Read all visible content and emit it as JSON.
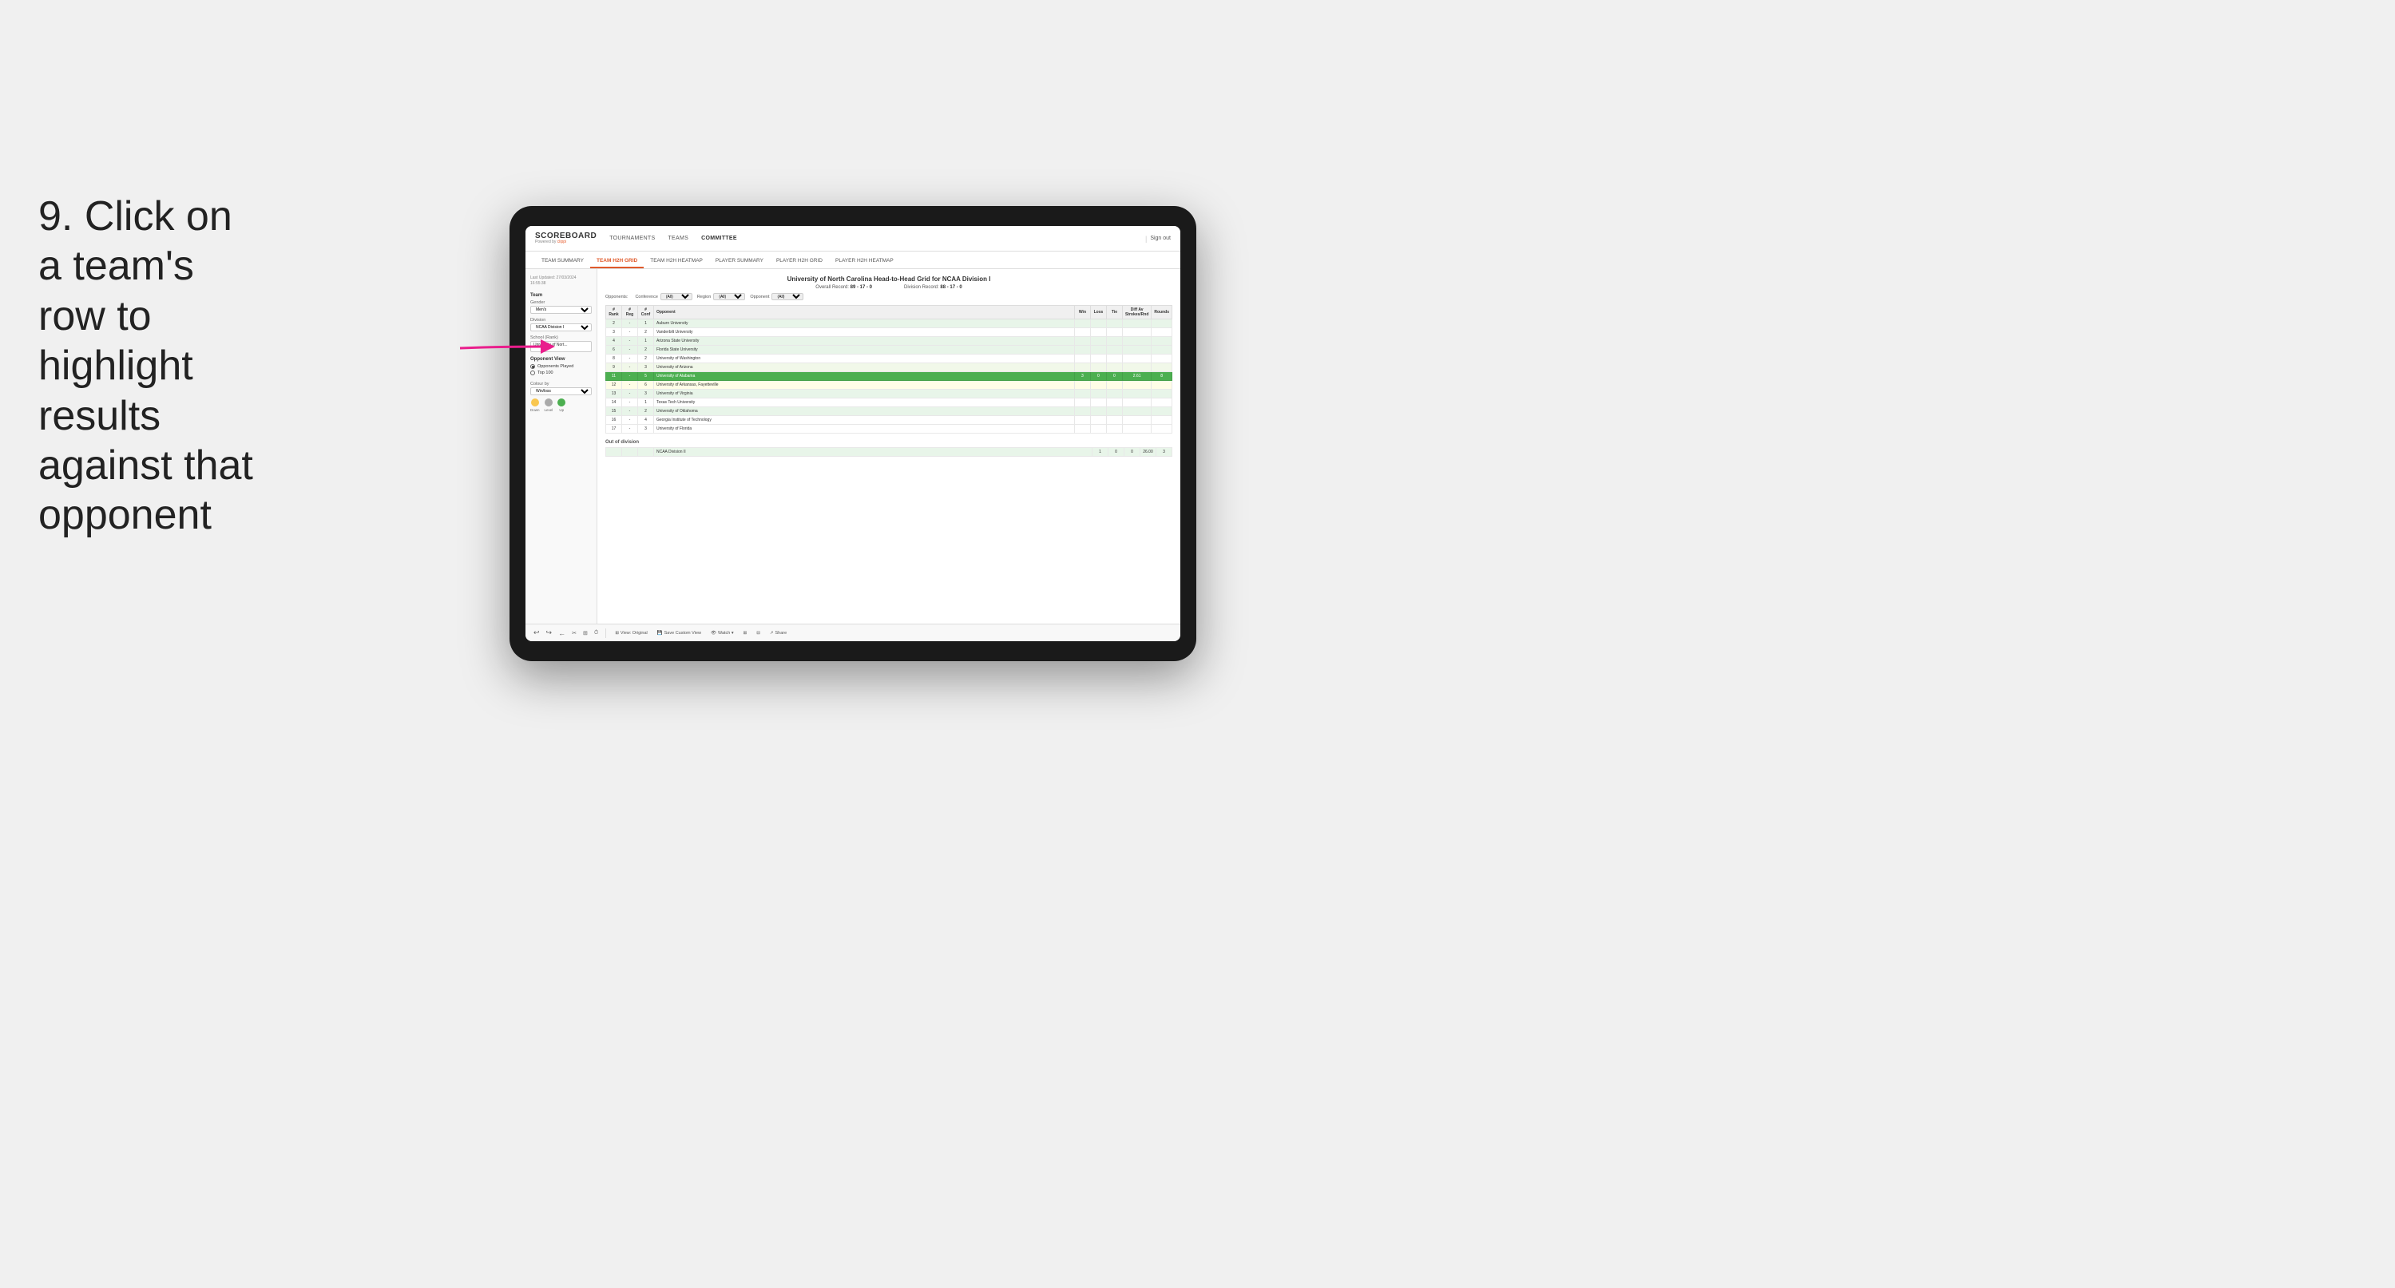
{
  "instruction": {
    "step": "9.",
    "text": "Click on a team's row to highlight results against that opponent"
  },
  "nav": {
    "logo": "SCOREBOARD",
    "powered_by": "Powered by clippi",
    "items": [
      "TOURNAMENTS",
      "TEAMS",
      "COMMITTEE"
    ],
    "sign_out": "Sign out"
  },
  "sub_nav": {
    "items": [
      "TEAM SUMMARY",
      "TEAM H2H GRID",
      "TEAM H2H HEATMAP",
      "PLAYER SUMMARY",
      "PLAYER H2H GRID",
      "PLAYER H2H HEATMAP"
    ],
    "active": "TEAM H2H GRID"
  },
  "sidebar": {
    "last_updated_label": "Last Updated: 27/03/2024",
    "last_updated_time": "16:55:38",
    "team_label": "Team",
    "gender_label": "Gender",
    "gender_value": "Men's",
    "division_label": "Division",
    "division_value": "NCAA Division I",
    "school_label": "School (Rank)",
    "school_value": "University of Nort...",
    "opponent_view_label": "Opponent View",
    "radio_opponents": "Opponents Played",
    "radio_top100": "Top 100",
    "colour_by_label": "Colour by",
    "colour_by_value": "Win/loss",
    "colours": [
      {
        "label": "Down",
        "color": "#f9c74f"
      },
      {
        "label": "Level",
        "color": "#aaaaaa"
      },
      {
        "label": "Up",
        "color": "#4caf50"
      }
    ]
  },
  "grid": {
    "title": "University of North Carolina Head-to-Head Grid for NCAA Division I",
    "overall_record_label": "Overall Record:",
    "overall_record": "89 - 17 - 0",
    "division_record_label": "Division Record:",
    "division_record": "88 - 17 - 0",
    "filters": {
      "opponents_label": "Opponents:",
      "conference_label": "Conference",
      "conference_value": "(All)",
      "region_label": "Region",
      "region_value": "(All)",
      "opponent_label": "Opponent",
      "opponent_value": "(All)"
    },
    "table_headers": [
      "#\nRank",
      "#\nReg",
      "#\nConf",
      "Opponent",
      "Win",
      "Loss",
      "Tie",
      "Diff Av\nStrokes/Rnd",
      "Rounds"
    ],
    "rows": [
      {
        "rank": "2",
        "reg": "-",
        "conf": "1",
        "opponent": "Auburn University",
        "win": "",
        "loss": "",
        "tie": "",
        "diff": "",
        "rounds": "",
        "style": "light-green"
      },
      {
        "rank": "3",
        "reg": "-",
        "conf": "2",
        "opponent": "Vanderbilt University",
        "win": "",
        "loss": "",
        "tie": "",
        "diff": "",
        "rounds": "",
        "style": ""
      },
      {
        "rank": "4",
        "reg": "-",
        "conf": "1",
        "opponent": "Arizona State University",
        "win": "",
        "loss": "",
        "tie": "",
        "diff": "",
        "rounds": "",
        "style": "light-green"
      },
      {
        "rank": "6",
        "reg": "-",
        "conf": "2",
        "opponent": "Florida State University",
        "win": "",
        "loss": "",
        "tie": "",
        "diff": "",
        "rounds": "",
        "style": "light-green"
      },
      {
        "rank": "8",
        "reg": "-",
        "conf": "2",
        "opponent": "University of Washington",
        "win": "",
        "loss": "",
        "tie": "",
        "diff": "",
        "rounds": "",
        "style": ""
      },
      {
        "rank": "9",
        "reg": "-",
        "conf": "3",
        "opponent": "University of Arizona",
        "win": "",
        "loss": "",
        "tie": "",
        "diff": "",
        "rounds": "",
        "style": "very-light-green"
      },
      {
        "rank": "11",
        "reg": "-",
        "conf": "5",
        "opponent": "University of Alabama",
        "win": "3",
        "loss": "0",
        "tie": "0",
        "diff": "2.61",
        "rounds": "8",
        "style": "highlighted"
      },
      {
        "rank": "12",
        "reg": "-",
        "conf": "6",
        "opponent": "University of Arkansas, Fayetteville",
        "win": "",
        "loss": "",
        "tie": "",
        "diff": "",
        "rounds": "",
        "style": "light-yellow"
      },
      {
        "rank": "13",
        "reg": "-",
        "conf": "3",
        "opponent": "University of Virginia",
        "win": "",
        "loss": "",
        "tie": "",
        "diff": "",
        "rounds": "",
        "style": "light-green"
      },
      {
        "rank": "14",
        "reg": "-",
        "conf": "1",
        "opponent": "Texas Tech University",
        "win": "",
        "loss": "",
        "tie": "",
        "diff": "",
        "rounds": "",
        "style": ""
      },
      {
        "rank": "15",
        "reg": "-",
        "conf": "2",
        "opponent": "University of Oklahoma",
        "win": "",
        "loss": "",
        "tie": "",
        "diff": "",
        "rounds": "",
        "style": "light-green"
      },
      {
        "rank": "16",
        "reg": "-",
        "conf": "4",
        "opponent": "Georgia Institute of Technology",
        "win": "",
        "loss": "",
        "tie": "",
        "diff": "",
        "rounds": "",
        "style": ""
      },
      {
        "rank": "17",
        "reg": "-",
        "conf": "3",
        "opponent": "University of Florida",
        "win": "",
        "loss": "",
        "tie": "",
        "diff": "",
        "rounds": "",
        "style": ""
      }
    ],
    "out_of_division_label": "Out of division",
    "out_of_div_row": {
      "label": "NCAA Division II",
      "win": "1",
      "loss": "0",
      "tie": "0",
      "diff": "26.00",
      "rounds": "3"
    }
  },
  "toolbar": {
    "undo": "↩",
    "redo": "↪",
    "back": "←",
    "view_original": "⊞ View: Original",
    "save_custom": "💾 Save Custom View",
    "watch": "👁 Watch ▾",
    "share": "↗ Share"
  },
  "colors": {
    "active_tab": "#e05a2b",
    "highlighted_row": "#4caf50",
    "light_green": "#e8f5e9",
    "very_light_green": "#f1f8e9",
    "light_yellow": "#fffde7"
  }
}
